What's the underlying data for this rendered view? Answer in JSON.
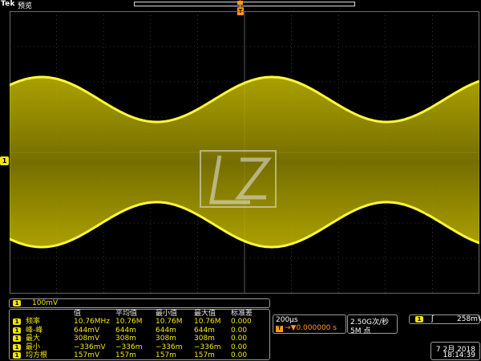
{
  "header": {
    "brand": "Tek",
    "mode": "预览"
  },
  "trigger_position_marker": "T",
  "channel": {
    "id": "1",
    "scale": "100mV"
  },
  "measurements": {
    "headers": [
      "值",
      "平均值",
      "最小值",
      "最大值",
      "标准差"
    ],
    "rows": [
      {
        "name": "频率",
        "values": [
          "10.76MHz",
          "10.76M",
          "10.76M",
          "10.76M",
          "0.000"
        ]
      },
      {
        "name": "峰-峰",
        "values": [
          "644mV",
          "644m",
          "644m",
          "644m",
          "0.00"
        ]
      },
      {
        "name": "最大",
        "values": [
          "308mV",
          "308m",
          "308m",
          "308m",
          "0.00"
        ]
      },
      {
        "name": "最小",
        "values": [
          "−336mV",
          "−336m",
          "−336m",
          "−336m",
          "0.00"
        ]
      },
      {
        "name": "均方根",
        "values": [
          "157mV",
          "157m",
          "157m",
          "157m",
          "0.00"
        ]
      }
    ]
  },
  "timebase": {
    "scale": "200µs",
    "trigger_time": "→▼0.000000 s",
    "trigger_time_icon": "T"
  },
  "acquisition": {
    "sample_rate": "2.50G次/秒",
    "record_length": "5M 点"
  },
  "trigger": {
    "source": "1",
    "slope_icon": "ʃ",
    "level": "258mV"
  },
  "datetime": {
    "date": "7 2月  2018",
    "time": "18:14:39"
  },
  "colors": {
    "channel1": "#f2e600",
    "trigger": "#ff9a1a",
    "background": "#000000",
    "graticule": "#5a5a5a"
  },
  "icons": {
    "channel_badge": "ch1-badge",
    "watermark": "zlg-logo"
  }
}
